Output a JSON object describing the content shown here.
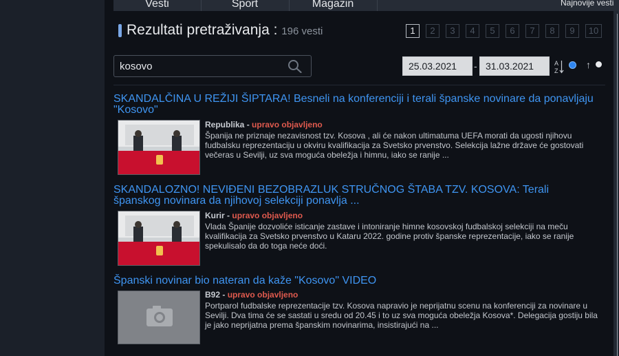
{
  "nav": {
    "tabs": [
      "Vesti",
      "Sport",
      "Magazin"
    ],
    "right_label": "Najnovije vesti"
  },
  "header": {
    "title": "Rezultati pretraživanja :",
    "count": "196 vesti"
  },
  "pagination": {
    "pages": [
      "1",
      "2",
      "3",
      "4",
      "5",
      "6",
      "7",
      "8",
      "9",
      "10"
    ],
    "current": "1"
  },
  "search": {
    "value": "kosovo",
    "date_from": "25.03.2021",
    "date_to": "31.03.2021",
    "date_separator": "-"
  },
  "colors": {
    "accent": "#3f95f2",
    "fresh": "#e05a4e",
    "radio_selected": "#2f86f0"
  },
  "articles": [
    {
      "title": "SKANDALČINA U REŽIJI ŠIPTARA! Besneli na konferenciji i terali španske novinare da ponavljaju \"Kosovo\"",
      "source": "Republika",
      "status": "upravo objavljeno",
      "summary": "Španija ne priznaje nezavisnost tzv. Kosova , ali će nakon ultimatuma UEFA morati da ugosti njihovu fudbalsku reprezentaciju u okviru kvalifikacija za Svetsko prvenstvo. Selekcija lažne države će gostovati večeras u Sevilji, uz sva moguća obeležja i himnu, iako se ranije ..."
    },
    {
      "title": "SKANDALOZNO! NEVIĐENI BEZOBRAZLUK STRUČNOG ŠTABA TZV. KOSOVA: Terali španskog novinara da njihovoj selekciji ponavlja ...",
      "source": "Kurir",
      "status": "upravo objavljeno",
      "summary": "Vlada Španije dozvoliće isticanje zastave i intoniranje himne kosovskoj fudbalskoj selekciji na meču kvalifikacija za Svetsko prvenstvo u Kataru 2022. godine protiv španske reprezentacije, iako se ranije spekulisalo da do toga neće doći."
    },
    {
      "title": "Španski novinar bio nateran da kaže \"Kosovo\" VIDEO",
      "source": "B92",
      "status": "upravo objavljeno",
      "summary": "Portparol fudbalske reprezentacije tzv. Kosova napravio je neprijatnu scenu na konferenciji za novinare u Sevilji. Dva tima će se sastati u sredu od 20.45 i to uz sva moguća obeležja Kosova*. Delegacija gostiju bila je jako neprijatna prema španskim novinarima, insistirajući na ..."
    }
  ]
}
